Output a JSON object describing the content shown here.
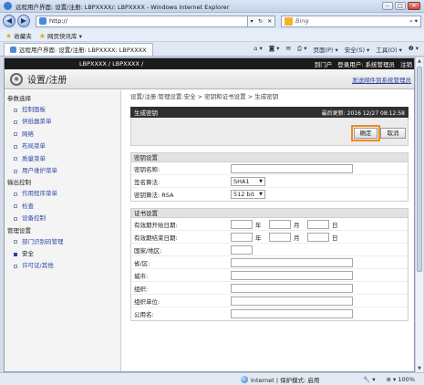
{
  "window": {
    "title": "远程用户界面: 设置/注册: LBPXXXX/: LBPXXXX - Windows Internet Explorer",
    "buttons": [
      "–",
      "□",
      "✕"
    ]
  },
  "browser": {
    "address": "http://",
    "search_placeholder": "Bing",
    "favorites_label": "收藏夹",
    "web_slice_label": "网页快讯库 ▾",
    "tab_title": "远程用户界面: 设置/注册: LBPXXXX: LBPXXXX",
    "commands": [
      "页面(P) ▾",
      "安全(S) ▾",
      "工具(O) ▾",
      "❷ ▾"
    ]
  },
  "app": {
    "model": "LBPXXXX / LBPXXXX /",
    "top_links": [
      "到门户",
      "登录用户: 系统管理员",
      "注销"
    ],
    "title": "设置/注册",
    "mail_link": "发送邮件到系统管理员"
  },
  "sidebar": {
    "groups": [
      {
        "label": "参数选择",
        "items": [
          "控制面板",
          "供纸器菜单",
          "网络",
          "布局菜单",
          "质量菜单",
          "用户维护菜单"
        ]
      },
      {
        "label": "输出控制",
        "items": [
          "作用程序菜单",
          "检查",
          "设备控制"
        ]
      },
      {
        "label": "管理设置",
        "items": [
          "部门识别码管理",
          "安全",
          "许可证/其他"
        ]
      }
    ],
    "active_item": "安全"
  },
  "content": {
    "breadcrumb": "设置/注册:管理设置:安全 > 密钥和证书设置 > 生成密钥",
    "panel_title": "生成密钥",
    "last_updated": "最后更新: 2016 12/27 08:12:58",
    "ok_label": "确定",
    "cancel_label": "取消",
    "key_section": {
      "title": "密钥设置",
      "key_name_label": "密钥名称:",
      "signature_label": "签名算法:",
      "signature_value": "SHA1",
      "key_algo_label": "密钥算法: RSA",
      "key_algo_value": "512 bit"
    },
    "cert_section": {
      "title": "证书设置",
      "start_label": "有效期开始日期:",
      "end_label": "有效期结束日期:",
      "year_unit": "年",
      "month_unit": "月",
      "day_unit": "日",
      "country_label": "国家/地区:",
      "province_label": "省/区:",
      "city_label": "城市:",
      "org_label": "组织:",
      "org_unit_label": "组织单位:",
      "common_name_label": "公用名:"
    }
  },
  "statusbar": {
    "zone": "Internet | 保护模式: 启用",
    "zoom": "100%",
    "zoom_icon": "⊕ ▾",
    "settings_icon": "🔧 ▾"
  }
}
